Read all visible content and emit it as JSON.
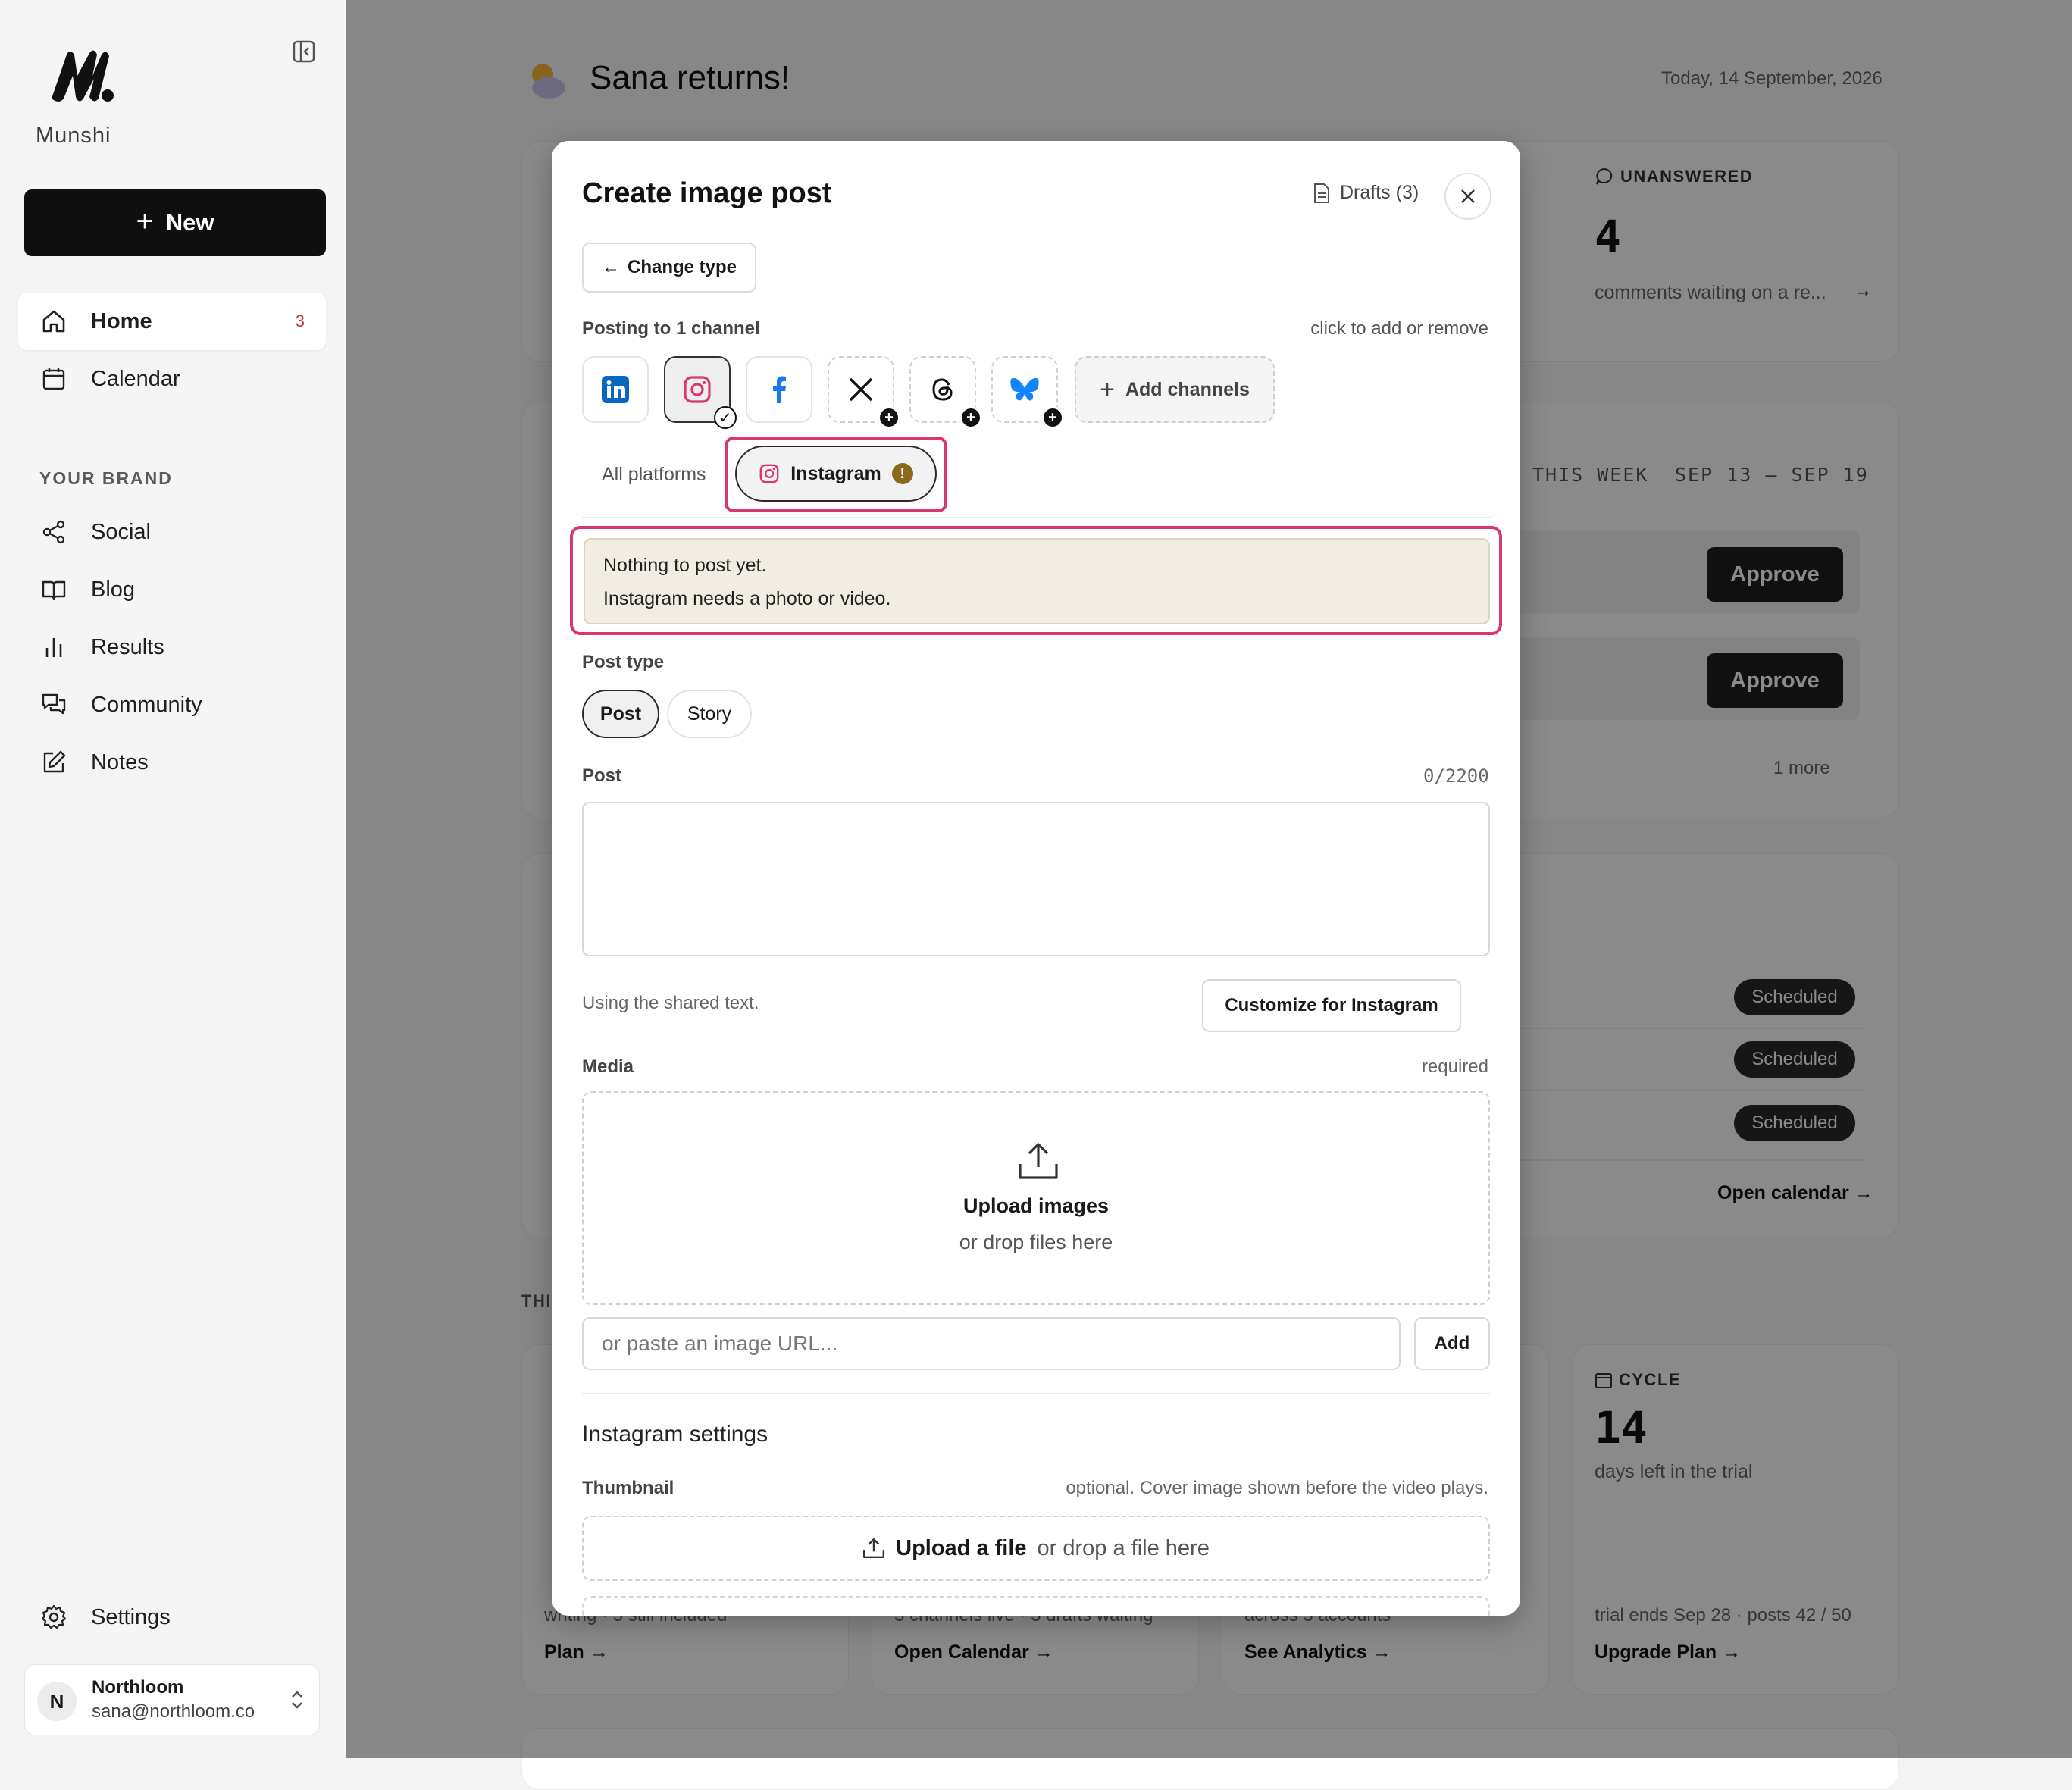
{
  "sidebar": {
    "brand": "Munshi",
    "new_label": "New",
    "nav": [
      {
        "label": "Home",
        "badge": "3"
      },
      {
        "label": "Calendar"
      }
    ],
    "section_label": "YOUR BRAND",
    "brand_nav": [
      {
        "label": "Social"
      },
      {
        "label": "Blog"
      },
      {
        "label": "Results"
      },
      {
        "label": "Community"
      },
      {
        "label": "Notes"
      }
    ],
    "settings_label": "Settings",
    "user": {
      "initial": "N",
      "name": "Northloom",
      "email": "sana@northloom.co"
    }
  },
  "dashboard": {
    "greeting": "Sana returns!",
    "date": "Today, 14 September, 2026",
    "unanswered": {
      "label": "UNANSWERED",
      "value": "4",
      "text": "comments waiting on a re..."
    },
    "week": {
      "label": "THIS WEEK",
      "range": "SEP 13 – SEP 19",
      "approve_label": "Approve",
      "more": "1 more"
    },
    "scheduled": {
      "badge": "Scheduled",
      "open_calendar": "Open calendar →"
    },
    "section_partial": "THI",
    "cards": [
      {
        "text": "writing · 3 still included",
        "link": "Plan →"
      },
      {
        "text": "3 channels live · 3 drafts waiting",
        "link": "Open Calendar →"
      },
      {
        "text": "across 3 accounts",
        "link": "See Analytics →"
      }
    ],
    "cycle": {
      "label": "CYCLE",
      "value": "14",
      "text": "days left in the trial",
      "meta": "trial ends Sep 28 · posts 42 / 50",
      "link": "Upgrade Plan →"
    }
  },
  "modal": {
    "title": "Create image post",
    "drafts": "Drafts (3)",
    "change_type": "Change type",
    "posting_to": "Posting to 1 channel",
    "posting_hint": "click to add or remove",
    "channels": [
      {
        "name": "LinkedIn",
        "icon": "linkedin-icon",
        "state": "available",
        "color": "#0a66c2"
      },
      {
        "name": "Instagram",
        "icon": "instagram-icon",
        "state": "selected",
        "color": "#d9386a"
      },
      {
        "name": "Facebook",
        "icon": "facebook-icon",
        "state": "available",
        "color": "#1877f2"
      },
      {
        "name": "X",
        "icon": "x-icon",
        "state": "not-connected",
        "color": "#111111"
      },
      {
        "name": "Threads",
        "icon": "threads-icon",
        "state": "not-connected",
        "color": "#111111"
      },
      {
        "name": "Bluesky",
        "icon": "bluesky-icon",
        "state": "not-connected",
        "color": "#1185fe"
      }
    ],
    "add_channels": "Add channels",
    "tabs": {
      "all": "All platforms",
      "instagram": "Instagram"
    },
    "alert": {
      "line1": "Nothing to post yet.",
      "line2": "Instagram needs a photo or video."
    },
    "post_type_label": "Post type",
    "post_types": [
      "Post",
      "Story"
    ],
    "selected_post_type": "Post",
    "post_label": "Post",
    "post_counter": "0/2200",
    "post_value": "",
    "shared_text": "Using the shared text.",
    "customize": "Customize for Instagram",
    "media_label": "Media",
    "media_required": "required",
    "upload_title": "Upload images",
    "upload_sub": "or drop files here",
    "url_placeholder": "or paste an image URL...",
    "add_label": "Add",
    "ig_settings": "Instagram settings",
    "thumbnail_label": "Thumbnail",
    "thumbnail_hint": "optional. Cover image shown before the video plays.",
    "thumb_upload": "Upload a file",
    "thumb_sub": "or drop a file here"
  },
  "colors": {
    "accent_highlight": "#d9386a",
    "warning": "#8a6a1a",
    "primary_dark": "#0f0f0f"
  }
}
